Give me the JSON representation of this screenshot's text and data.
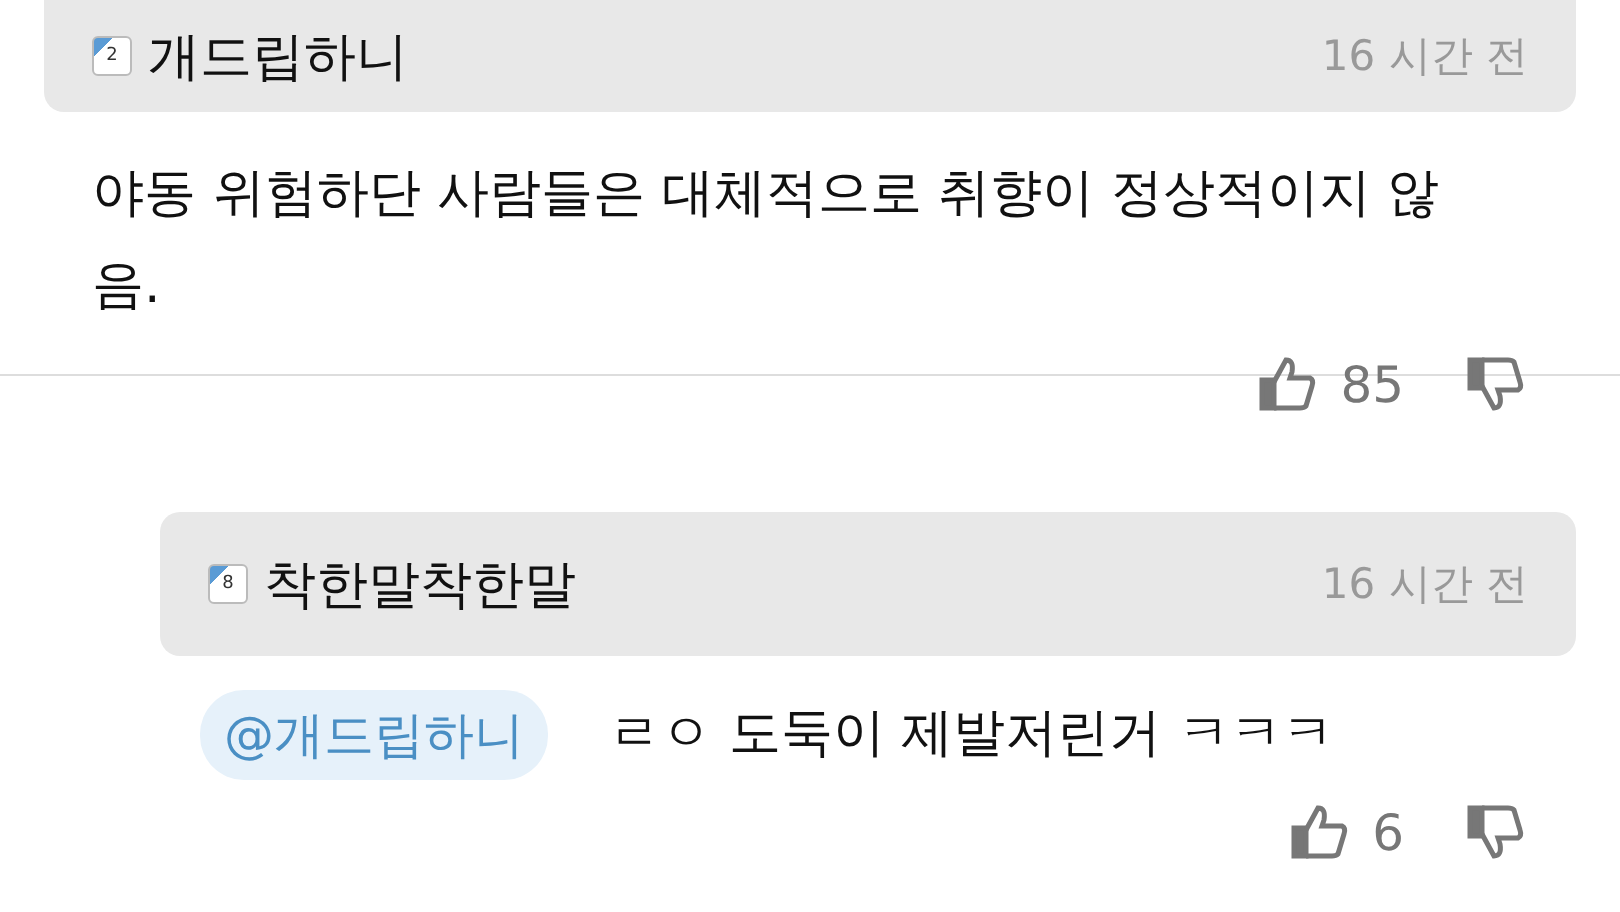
{
  "comments": [
    {
      "kind": "comment",
      "badge": "2",
      "author": "개드립하니",
      "time": "16 시간 전",
      "lines": [
        "야동 위험하단 사람들은 대체적으로 취향이 정상적이지 않",
        "음."
      ],
      "likes": "85"
    },
    {
      "kind": "reply",
      "badge": "8",
      "author": "착한말착한말",
      "time": "16 시간 전",
      "mention": "@개드립하니",
      "lines": [
        "ㄹㅇ 도둑이 제발저린거 ㅋㅋㅋ"
      ],
      "likes": "6"
    }
  ]
}
